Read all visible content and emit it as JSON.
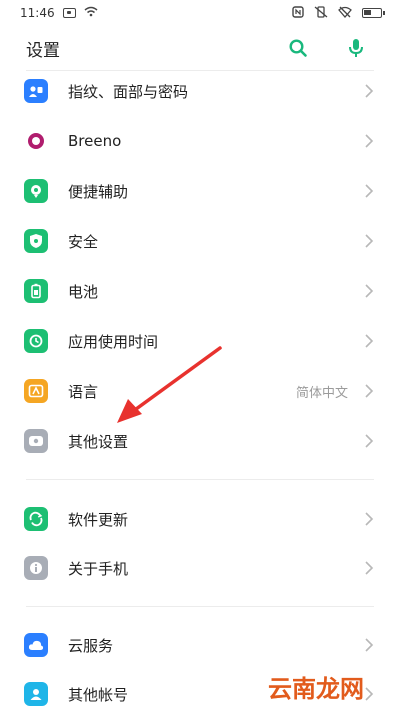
{
  "status_bar": {
    "time": "11:46"
  },
  "header": {
    "title": "设置"
  },
  "settings_group_1": [
    {
      "label": "指纹、面部与密码",
      "icon": "fingerprint-face-icon",
      "color": "#2b7fff",
      "value": ""
    },
    {
      "label": "Breeno",
      "icon": "breeno-icon",
      "color": "#b01d6e",
      "value": ""
    },
    {
      "label": "便捷辅助",
      "icon": "assist-icon",
      "color": "#1dbf73",
      "value": ""
    },
    {
      "label": "安全",
      "icon": "shield-icon",
      "color": "#1dbf73",
      "value": ""
    },
    {
      "label": "电池",
      "icon": "battery-icon",
      "color": "#1dbf73",
      "value": ""
    },
    {
      "label": "应用使用时间",
      "icon": "app-usage-icon",
      "color": "#1dbf73",
      "value": ""
    },
    {
      "label": "语言",
      "icon": "language-icon",
      "color": "#f5a623",
      "value": "简体中文"
    },
    {
      "label": "其他设置",
      "icon": "other-settings-icon",
      "color": "#a8adb6",
      "value": ""
    }
  ],
  "settings_group_2": [
    {
      "label": "软件更新",
      "icon": "software-update-icon",
      "color": "#1dbf73"
    },
    {
      "label": "关于手机",
      "icon": "about-phone-icon",
      "color": "#a8adb6"
    }
  ],
  "settings_group_3": [
    {
      "label": "云服务",
      "icon": "cloud-icon",
      "color": "#2b7fff"
    },
    {
      "label": "其他帐号",
      "icon": "accounts-icon",
      "color": "#1fb5e8"
    }
  ],
  "accent_color": "#19b87d",
  "annotation": {
    "arrow_color": "#e8322e"
  },
  "watermark": {
    "text": "云南龙网"
  }
}
